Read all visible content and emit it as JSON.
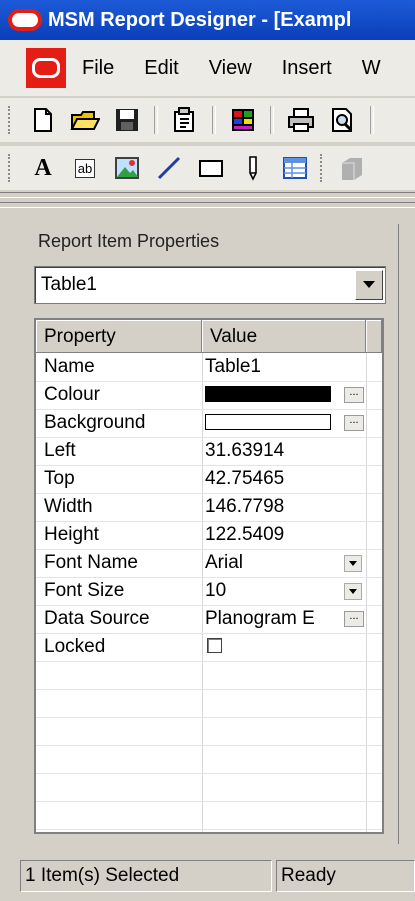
{
  "window": {
    "title": "MSM Report Designer - [Exampl"
  },
  "menu": [
    "File",
    "Edit",
    "View",
    "Insert",
    "W"
  ],
  "toolbar1": {
    "icons": [
      "new-icon",
      "open-folder-icon",
      "save-icon",
      "properties-icon",
      "color-palette-icon",
      "print-icon",
      "print-preview-icon"
    ]
  },
  "toolbar2": {
    "text_tool": "A",
    "textbox_tool": "ab",
    "icons": [
      "image-tool-icon",
      "line-tool-icon",
      "rectangle-tool-icon",
      "pencil-tool-icon",
      "table-tool-icon",
      "gray-box-icon"
    ]
  },
  "panel": {
    "title": "Report Item Properties",
    "selected_object": "Table1",
    "columns": {
      "property": "Property",
      "value": "Value"
    },
    "rows": [
      {
        "property": "Name",
        "value": "Table1"
      },
      {
        "property": "Colour",
        "value": "",
        "swatch": "#000000",
        "has_ellipsis": true
      },
      {
        "property": "Background",
        "value": "",
        "swatch": "#ffffff",
        "has_ellipsis": true
      },
      {
        "property": "Left",
        "value": "31.63914"
      },
      {
        "property": "Top",
        "value": "42.75465"
      },
      {
        "property": "Width",
        "value": "146.7798"
      },
      {
        "property": "Height",
        "value": "122.5409"
      },
      {
        "property": "Font Name",
        "value": "Arial",
        "has_dropdown": true
      },
      {
        "property": "Font Size",
        "value": "10",
        "has_dropdown": true
      },
      {
        "property": "Data Source",
        "value": "Planogram E",
        "has_ellipsis": true
      },
      {
        "property": "Locked",
        "value": "",
        "checkbox": false
      }
    ],
    "ellipsis": "...",
    "dropdown_glyph": "▼"
  },
  "status": {
    "selection": "1 Item(s) Selected",
    "state": "Ready"
  }
}
